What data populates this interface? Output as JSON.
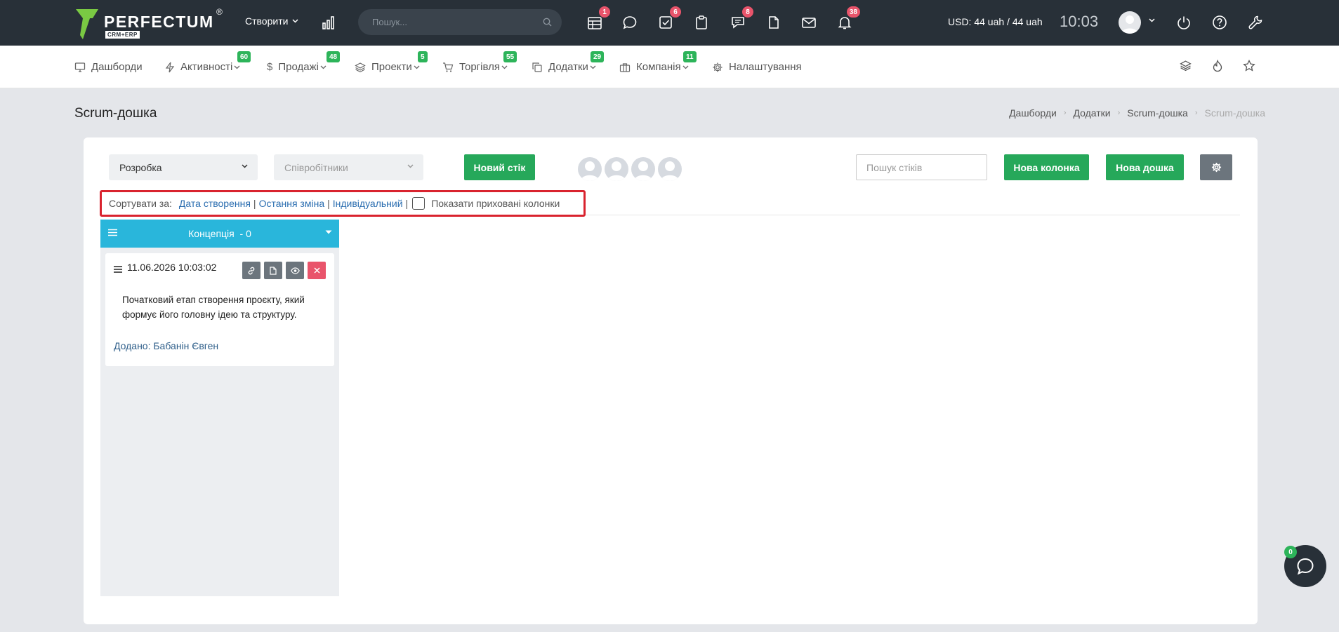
{
  "app": {
    "logo_text": "PERFECTUM",
    "logo_reg": "®",
    "logo_sub": "CRM+ERP",
    "accent_color": "#7ac943"
  },
  "topbar": {
    "create_label": "Створити",
    "search_placeholder": "Пошук...",
    "badges": {
      "calendar": "1",
      "tasks": "6",
      "messages": "8",
      "notifications": "38"
    },
    "currency": "USD: 44  uah / 44 uah",
    "time": "10:03"
  },
  "nav": {
    "items": [
      {
        "label": "Дашборди",
        "icon": "monitor-icon"
      },
      {
        "label": "Активності",
        "icon": "bolt-icon",
        "badge": "60"
      },
      {
        "label": "Продажі",
        "icon": "dollar-icon",
        "badge": "48"
      },
      {
        "label": "Проекти",
        "icon": "layers-icon",
        "badge": "5"
      },
      {
        "label": "Торгівля",
        "icon": "cart-icon",
        "badge": "55"
      },
      {
        "label": "Додатки",
        "icon": "copy-icon",
        "badge": "29"
      },
      {
        "label": "Компанія",
        "icon": "briefcase-icon",
        "badge": "11"
      },
      {
        "label": "Налаштування",
        "icon": "gear-icon"
      }
    ]
  },
  "page": {
    "title": "Scrum-дошка",
    "breadcrumb": [
      "Дашборди",
      "Додатки",
      "Scrum-дошка",
      "Scrum-дошка"
    ]
  },
  "toolbar": {
    "board_select": "Розробка",
    "employees_placeholder": "Співробітники",
    "new_sticker": "Новий стік",
    "sticker_search_placeholder": "Пошук стіків",
    "new_column": "Нова колонка",
    "new_board": "Нова дошка"
  },
  "sort": {
    "label": "Сортувати за:",
    "options": [
      "Дата створення",
      "Остання зміна",
      "Індивідуальний"
    ],
    "separator": "|",
    "show_hidden": "Показати приховані колонки"
  },
  "columns": [
    {
      "title": "Концепція  - 0",
      "color": "#29b6db",
      "cards": [
        {
          "date": "11.06.2026 10:03:02",
          "text": "Початковий етап створення проєкту, який формує його головну ідею та структуру.",
          "author": "Додано: Бабанін Євген"
        }
      ]
    }
  ],
  "chat": {
    "badge": "0"
  }
}
